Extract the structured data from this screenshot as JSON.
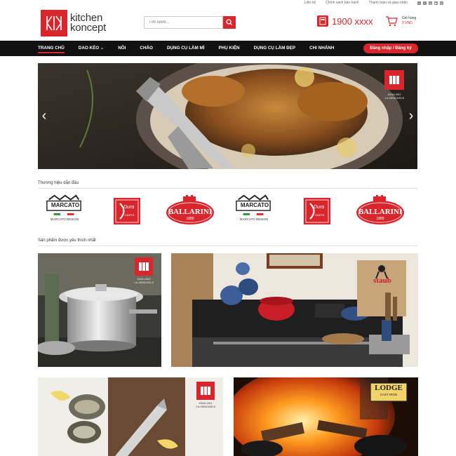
{
  "topbar": {
    "links": [
      "Liên hệ",
      "Chính sách bảo hành",
      "Thanh toán và giao nhận"
    ],
    "social_icons": [
      "facebook-icon",
      "twitter-icon",
      "google-plus-icon",
      "youtube-icon",
      "instagram-icon"
    ]
  },
  "header": {
    "logo_line1": "kitchen",
    "logo_line2": "koncept",
    "search_placeholder": "Tìm kiếm...",
    "hotline": "1900 xxxx",
    "cart_label": "Giỏ hàng",
    "cart_total": "0 VND"
  },
  "nav": {
    "items": [
      "TRANG CHỦ",
      "DAO KÉO",
      "NỒI",
      "CHẢO",
      "DỤNG CỤ LÀM MÌ",
      "PHỤ KIỆN",
      "DỤNG CỤ LÀM ĐẸP",
      "CHI NHÁNH"
    ],
    "dropdown_marker": "⌄",
    "login": "Đăng nhập / Đăng ký"
  },
  "banner": {
    "brand_caption_1": "ZWILLING",
    "brand_caption_2": "J.A.HENCKELS",
    "prev": "‹",
    "next": "›"
  },
  "sections": {
    "brands_title": "Thương hiệu dẫn đầu",
    "popular_title": "Sản phẩm được yêu thích nhất"
  },
  "brands": {
    "marcato": "MARCATO",
    "marcato_sub": "MARCATO DESIGN",
    "dura": "Dura",
    "dura_sub": "CASTS",
    "ballarini": "BALLARINI",
    "ballarini_year": "1889"
  },
  "tiles": {
    "tile1_caption_1": "ZWILLING",
    "tile1_caption_2": "J.A.HENCKELS",
    "tile2_brand": "staub",
    "tile3_caption_1": "ZWILLING",
    "tile3_caption_2": "J.A.HENCKELS",
    "tile4_brand": "LODGE",
    "tile4_sub": "CAST IRON"
  },
  "colors": {
    "brand_red": "#d9262c",
    "nav_bg": "#111111"
  }
}
